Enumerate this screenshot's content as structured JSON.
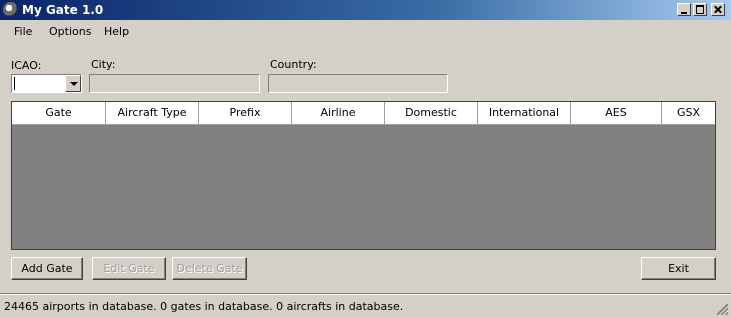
{
  "window": {
    "title": "My Gate 1.0"
  },
  "menu": {
    "items": [
      "File",
      "Options",
      "Help"
    ]
  },
  "form": {
    "icao_label": "ICAO:",
    "icao_value": "",
    "city_label": "City:",
    "city_value": "",
    "country_label": "Country:",
    "country_value": ""
  },
  "table": {
    "columns": [
      "Gate",
      "Aircraft Type",
      "Prefix",
      "Airline",
      "Domestic",
      "International",
      "AES",
      "GSX"
    ],
    "rows": []
  },
  "buttons": {
    "add_gate": "Add Gate",
    "edit_gate": "Edit Gate",
    "delete_gate": "Delete Gate",
    "exit": "Exit"
  },
  "status": {
    "text": "24465 airports in database.  0 gates in database.  0 aircrafts in database."
  }
}
